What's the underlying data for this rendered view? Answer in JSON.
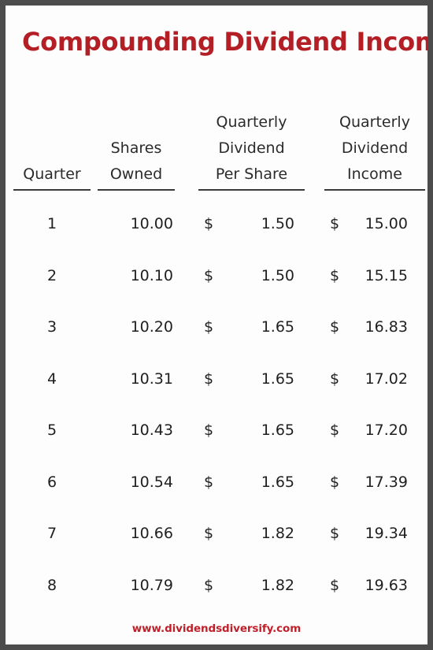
{
  "document": {
    "title": "Compounding Dividend Income",
    "footer_url": "www.dividendsdiversify.com",
    "accent_color": "#b41f26",
    "footer_color": "#c02029",
    "frame_color": "#4c4c4c",
    "page_background": "#fdfdfd"
  },
  "table": {
    "columns": [
      {
        "key": "quarter",
        "lines": [
          "Quarter"
        ]
      },
      {
        "key": "shares",
        "lines": [
          "Shares",
          "Owned"
        ]
      },
      {
        "key": "dps",
        "lines": [
          "Quarterly",
          "Dividend",
          "Per Share"
        ]
      },
      {
        "key": "income",
        "lines": [
          "Quarterly",
          "Dividend",
          "Income"
        ]
      }
    ],
    "headers": {
      "quarter": {
        "l1": "",
        "l2": "",
        "l3": "Quarter"
      },
      "shares": {
        "l1": "",
        "l2": "Shares",
        "l3": "Owned"
      },
      "dps": {
        "l1": "Quarterly",
        "l2": "Dividend",
        "l3": "Per Share"
      },
      "income": {
        "l1": "Quarterly",
        "l2": "Dividend",
        "l3": "Income"
      }
    },
    "currency_symbol": "$",
    "rows": [
      {
        "quarter": "1",
        "shares": "10.00",
        "cur1": "$",
        "dps": "1.50",
        "cur2": "$",
        "income": "15.00"
      },
      {
        "quarter": "2",
        "shares": "10.10",
        "cur1": "$",
        "dps": "1.50",
        "cur2": "$",
        "income": "15.15"
      },
      {
        "quarter": "3",
        "shares": "10.20",
        "cur1": "$",
        "dps": "1.65",
        "cur2": "$",
        "income": "16.83"
      },
      {
        "quarter": "4",
        "shares": "10.31",
        "cur1": "$",
        "dps": "1.65",
        "cur2": "$",
        "income": "17.02"
      },
      {
        "quarter": "5",
        "shares": "10.43",
        "cur1": "$",
        "dps": "1.65",
        "cur2": "$",
        "income": "17.20"
      },
      {
        "quarter": "6",
        "shares": "10.54",
        "cur1": "$",
        "dps": "1.65",
        "cur2": "$",
        "income": "17.39"
      },
      {
        "quarter": "7",
        "shares": "10.66",
        "cur1": "$",
        "dps": "1.82",
        "cur2": "$",
        "income": "19.34"
      },
      {
        "quarter": "8",
        "shares": "10.79",
        "cur1": "$",
        "dps": "1.82",
        "cur2": "$",
        "income": "19.63"
      }
    ]
  },
  "chart_data": {
    "type": "table",
    "title": "Compounding Dividend Income",
    "columns": [
      "Quarter",
      "Shares Owned",
      "Quarterly Dividend Per Share",
      "Quarterly Dividend Income"
    ],
    "quarters": [
      1,
      2,
      3,
      4,
      5,
      6,
      7,
      8
    ],
    "series": [
      {
        "name": "Shares Owned",
        "values": [
          10.0,
          10.1,
          10.2,
          10.31,
          10.43,
          10.54,
          10.66,
          10.79
        ]
      },
      {
        "name": "Quarterly Dividend Per Share",
        "values": [
          1.5,
          1.5,
          1.65,
          1.65,
          1.65,
          1.65,
          1.82,
          1.82
        ]
      },
      {
        "name": "Quarterly Dividend Income",
        "values": [
          15.0,
          15.15,
          16.83,
          17.02,
          17.2,
          17.39,
          19.34,
          19.63
        ]
      }
    ],
    "xlabel": "Quarter",
    "ylabel": ""
  }
}
